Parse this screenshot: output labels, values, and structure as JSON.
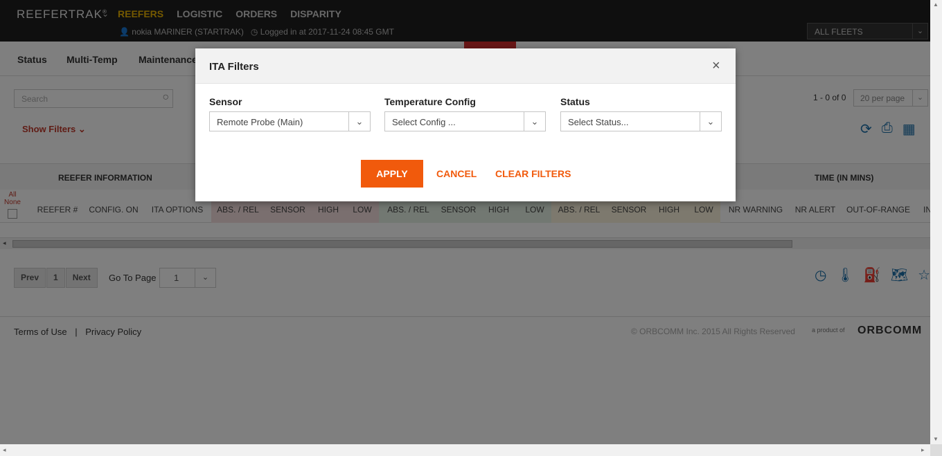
{
  "app": {
    "logo": "REEFERTRAK",
    "logo_mark": "®",
    "nav": [
      "REEFERS",
      "LOGISTIC",
      "ORDERS",
      "DISPARITY"
    ],
    "user": "nokia MARINER (STARTRAK)",
    "login": "Logged in at 2017-11-24 08:45 GMT",
    "fleet": "ALL FLEETS"
  },
  "subnav": [
    "Status",
    "Multi-Temp",
    "Maintenance"
  ],
  "toolbar": {
    "search_placeholder": "Search",
    "show_filters": "Show Filters",
    "paging": "1 - 0 of 0",
    "per_page": "20 per page"
  },
  "table": {
    "group1": "REEFER INFORMATION",
    "group2": "TIME (IN MINS)",
    "all": "All",
    "none": "None",
    "columns": [
      "REEFER #",
      "CONFIG. ON",
      "ITA OPTIONS",
      "ABS. / REL",
      "SENSOR",
      "HIGH",
      "LOW",
      "ABS. / REL",
      "SENSOR",
      "HIGH",
      "LOW",
      "ABS. / REL",
      "SENSOR",
      "HIGH",
      "LOW",
      "NR WARNING",
      "NR ALERT",
      "OUT-OF-RANGE",
      "IN"
    ]
  },
  "pager": {
    "prev": "Prev",
    "page": "1",
    "next": "Next",
    "goto_label": "Go To Page",
    "goto_value": "1"
  },
  "footer": {
    "terms": "Terms of Use",
    "privacy": "Privacy Policy",
    "copyright": "© ORBCOMM Inc. 2015 All Rights Reserved",
    "product_of": "a product of",
    "brand": "ORBCOMM"
  },
  "modal": {
    "title": "ITA Filters",
    "close": "×",
    "sensor_label": "Sensor",
    "sensor_value": "Remote Probe (Main)",
    "temp_label": "Temperature Config",
    "temp_value": "Select Config ...",
    "status_label": "Status",
    "status_value": "Select Status...",
    "apply": "APPLY",
    "cancel": "CANCEL",
    "clear": "CLEAR FILTERS"
  },
  "colors": {
    "accent": "#f15a0c",
    "nav_active": "#e8b200",
    "filter_red": "#c0392b",
    "col_red": "#f4dede",
    "col_green": "#e4f1e4",
    "col_yellow": "#faf2dc"
  }
}
